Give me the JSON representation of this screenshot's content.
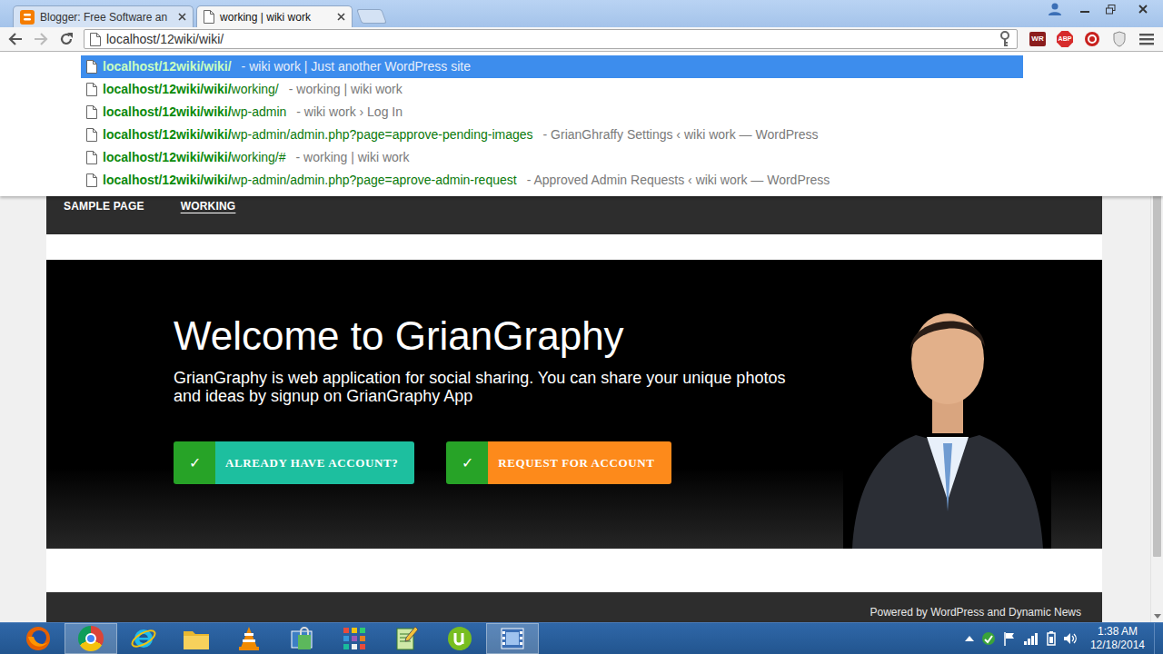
{
  "tabs": [
    {
      "label": "Blogger: Free Software an",
      "selected": false,
      "kind": "blogger"
    },
    {
      "label": "working | wiki work",
      "selected": true,
      "kind": "page"
    }
  ],
  "toolbar": {
    "address": "localhost/12wiki/wiki/",
    "extensions": [
      {
        "label": "WR",
        "kind": "wr"
      },
      {
        "label": "ABP",
        "kind": "abp"
      }
    ]
  },
  "suggestions": [
    {
      "match": "localhost/12wiki/wiki/",
      "rest": "",
      "title": "- wiki work | Just another WordPress site",
      "selected": true
    },
    {
      "match": "localhost/12wiki/wiki/",
      "rest": "working/",
      "title": "- working | wiki work",
      "selected": false
    },
    {
      "match": "localhost/12wiki/wiki/",
      "rest": "wp-admin",
      "title": "- wiki work › Log In",
      "selected": false
    },
    {
      "match": "localhost/12wiki/wiki/",
      "rest": "wp-admin/admin.php?page=approve-pending-images",
      "title": "- GrianGhraffy Settings ‹ wiki work — WordPress",
      "selected": false
    },
    {
      "match": "localhost/12wiki/wiki/",
      "rest": "working/#",
      "title": "- working | wiki work",
      "selected": false
    },
    {
      "match": "localhost/12wiki/wiki/",
      "rest": "wp-admin/admin.php?page=aprove-admin-request",
      "title": "- Approved Admin Requests ‹ wiki work — WordPress",
      "selected": false
    }
  ],
  "page": {
    "menu": [
      {
        "label": "SAMPLE PAGE",
        "selected": false
      },
      {
        "label": "WORKING",
        "selected": true
      }
    ],
    "hero": {
      "heading": "Welcome to GrianGraphy",
      "text": "GrianGraphy is web application for social sharing. You can share your unique photos and ideas by signup on GrianGraphy App",
      "buttons": [
        {
          "check": "✓",
          "label": "ALREADY HAVE ACCOUNT?",
          "color": "#1dbf9f"
        },
        {
          "check": "✓",
          "label": "REQUEST FOR ACCOUNT",
          "color": "#fd8a1b"
        }
      ]
    },
    "footer": "Powered by WordPress and Dynamic News"
  },
  "taskbar": {
    "apps": [
      {
        "kind": "firefox",
        "selected": false
      },
      {
        "kind": "chrome",
        "selected": true
      },
      {
        "kind": "ie",
        "selected": false
      },
      {
        "kind": "explorer",
        "selected": false
      },
      {
        "kind": "vlc",
        "selected": false
      },
      {
        "kind": "security",
        "selected": false
      },
      {
        "kind": "apps",
        "selected": false
      },
      {
        "kind": "notepad",
        "selected": false
      },
      {
        "kind": "utorrent",
        "selected": false
      },
      {
        "kind": "video",
        "selected": true
      }
    ],
    "clock": {
      "time": "1:38 AM",
      "date": "12/18/2014"
    }
  }
}
